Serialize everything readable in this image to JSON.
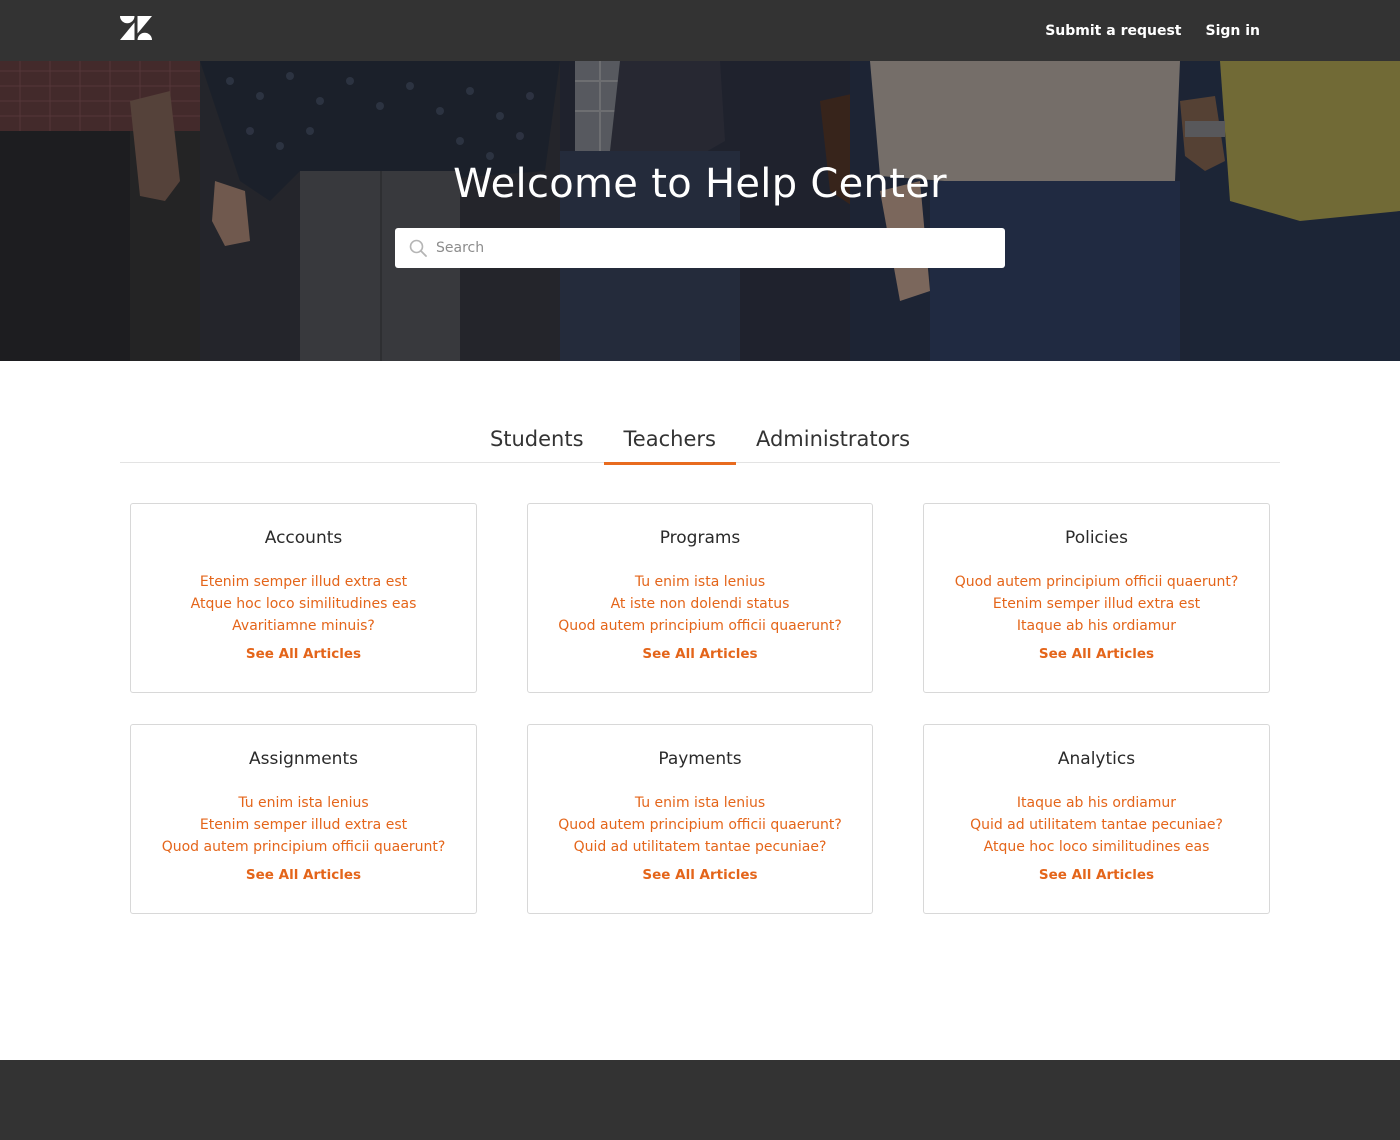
{
  "header": {
    "logo": "zendesk-logo",
    "submit_label": "Submit a request",
    "signin_label": "Sign in"
  },
  "hero": {
    "title": "Welcome to Help Center",
    "search_placeholder": "Search"
  },
  "tabs": [
    {
      "label": "Students",
      "active": false
    },
    {
      "label": "Teachers",
      "active": true
    },
    {
      "label": "Administrators",
      "active": false
    }
  ],
  "cards": [
    {
      "title": "Accounts",
      "links": [
        "Etenim semper illud extra est",
        "Atque hoc loco similitudines eas",
        "Avaritiamne minuis?"
      ],
      "see_all": "See All Articles"
    },
    {
      "title": "Programs",
      "links": [
        "Tu enim ista lenius",
        "At iste non dolendi status",
        "Quod autem principium officii quaerunt?"
      ],
      "see_all": "See All Articles"
    },
    {
      "title": "Policies",
      "links": [
        "Quod autem principium officii quaerunt?",
        "Etenim semper illud extra est",
        "Itaque ab his ordiamur"
      ],
      "see_all": "See All Articles"
    },
    {
      "title": "Assignments",
      "links": [
        "Tu enim ista lenius",
        "Etenim semper illud extra est",
        "Quod autem principium officii quaerunt?"
      ],
      "see_all": "See All Articles"
    },
    {
      "title": "Payments",
      "links": [
        "Tu enim ista lenius",
        "Quod autem principium officii quaerunt?",
        "Quid ad utilitatem tantae pecuniae?"
      ],
      "see_all": "See All Articles"
    },
    {
      "title": "Analytics",
      "links": [
        "Itaque ab his ordiamur",
        "Quid ad utilitatem tantae pecuniae?",
        "Atque hoc loco similitudines eas"
      ],
      "see_all": "See All Articles"
    }
  ],
  "colors": {
    "accent": "#e4651a",
    "header_bg": "#333333",
    "footer_bg": "#333333"
  }
}
